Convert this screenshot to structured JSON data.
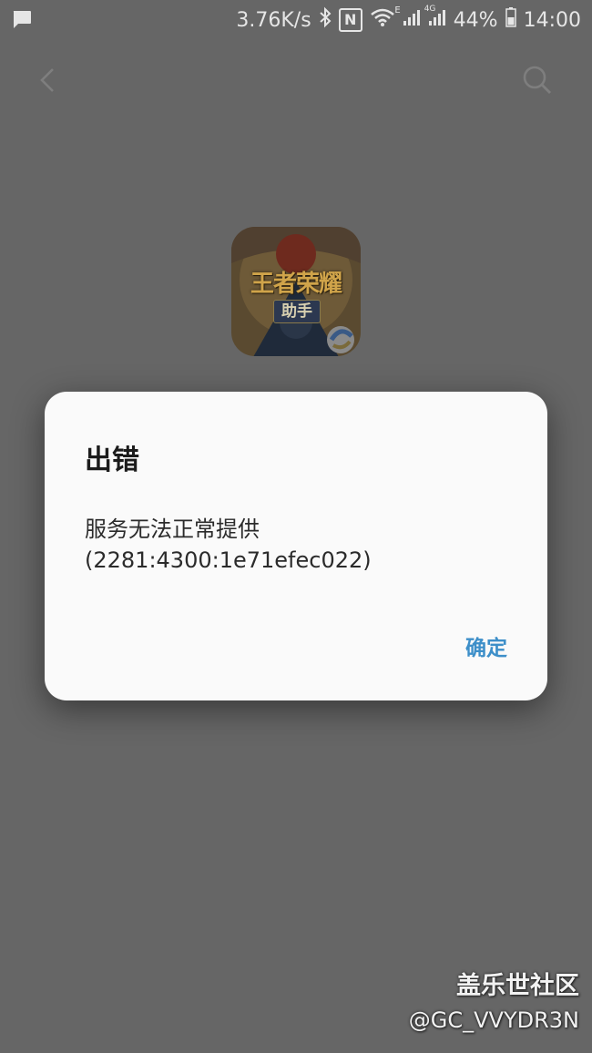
{
  "status_bar": {
    "net_speed": "3.76K/s",
    "nfc": "N",
    "wifi_tag": "E",
    "lte_tag": "4G",
    "battery_level": "44%",
    "time": "14:00",
    "icons": [
      "message-icon",
      "bluetooth-icon",
      "nfc-icon",
      "wifi-icon",
      "signal-icon",
      "signal-4g-icon",
      "battery-icon"
    ]
  },
  "app_bar": {
    "icons": [
      "back-arrow-icon",
      "search-icon"
    ]
  },
  "app_icon": {
    "name_line1": "王者荣耀",
    "name_line2": "助手"
  },
  "dialog": {
    "title": "出错",
    "message_line1": "服务无法正常提供",
    "message_line2": "(2281:4300:1e71efec022)",
    "confirm_label": "确定"
  },
  "watermark": {
    "line1": "盖乐世社区",
    "line2": "@GC_VVYDR3N"
  },
  "colors": {
    "overlay_bg": "#666666",
    "dialog_bg": "#fafafa",
    "confirm_button": "#3d8fc9"
  }
}
